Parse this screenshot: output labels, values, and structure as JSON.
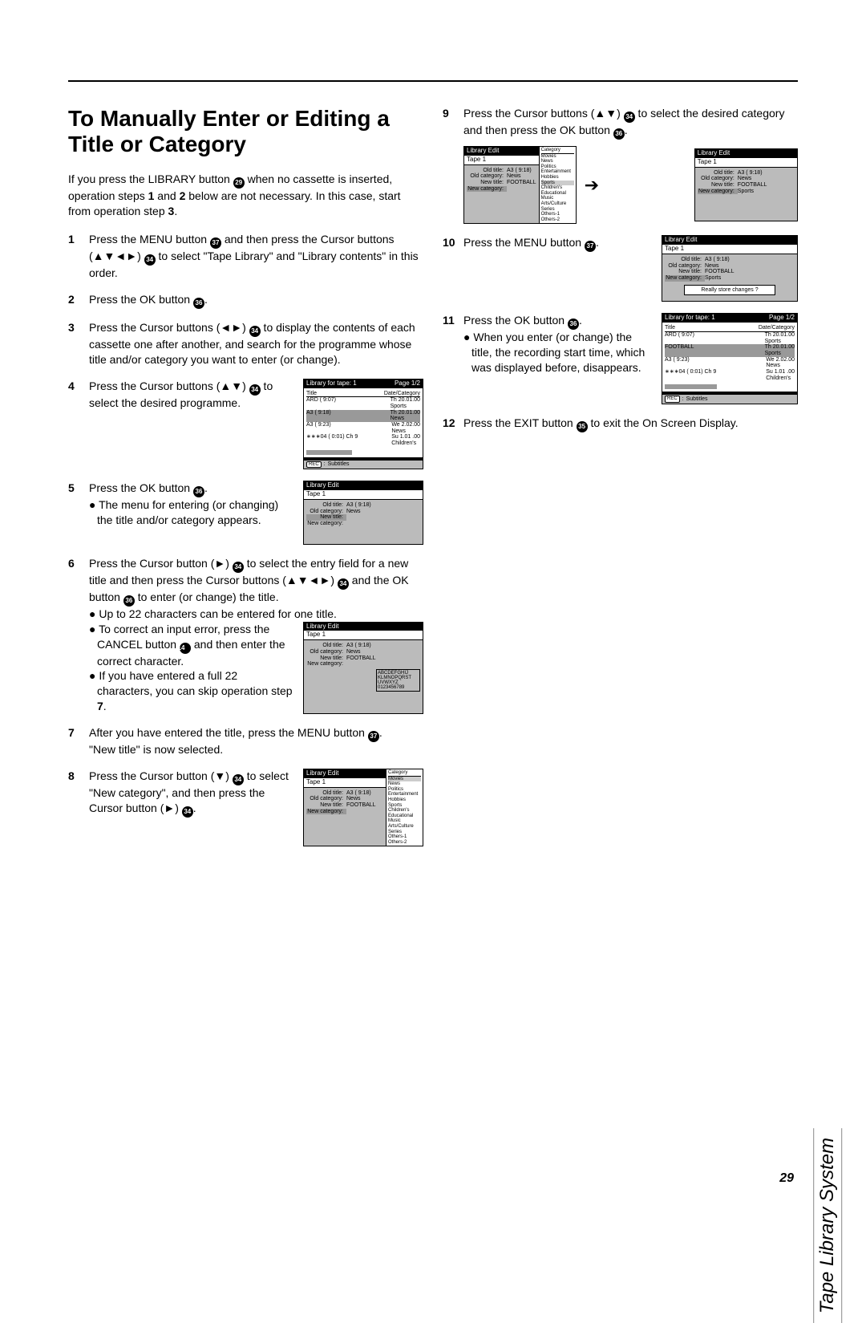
{
  "page_number": "29",
  "side_tab": "Tape Library System",
  "h1": "To Manually Enter or Editing a Title or Category",
  "intro_a": "If you press the LIBRARY button ",
  "intro_b": " when no cassette is inserted, operation steps ",
  "intro_c": " and ",
  "intro_d": " below are not necessary. In this case, start from operation step ",
  "intro_e": ".",
  "bold1": "1",
  "bold2": "2",
  "bold3": "3",
  "step1_a": "Press the MENU button ",
  "step1_b": " and then press the Cursor buttons (▲▼◄►) ",
  "step1_c": " to select \"Tape Library\" and \"Library contents\" in this order.",
  "step2_a": "Press the OK button ",
  "step2_b": ".",
  "step3_a": "Press the Cursor buttons (◄►) ",
  "step3_b": " to display the contents of each cassette one after another, and search for the programme whose title and/or category you want to enter (or change).",
  "step4_a": "Press the Cursor buttons (▲▼) ",
  "step4_b": " to select the desired programme.",
  "step5_a": "Press the OK button ",
  "step5_b": ".",
  "step5_bul": "The menu for entering (or changing) the title and/or category appears.",
  "step6_a": "Press the Cursor button (►) ",
  "step6_b": " to select the entry field for a new title and then press the Cursor buttons (▲▼◄►) ",
  "step6_c": " and the OK button ",
  "step6_d": " to enter (or change) the title.",
  "step6_bul1": "Up to 22 characters can be entered for one title.",
  "step6_bul2a": "To correct an input error, press the CANCEL button ",
  "step6_bul2b": " and then enter the correct character.",
  "step6_bul3": "If you have entered a full 22 characters, you can skip operation step ",
  "step6_bul3b": ".",
  "bold7": "7",
  "step7_a": "After you have entered the title, press the MENU button ",
  "step7_b": ".",
  "step7_c": "\"New title\" is now selected.",
  "step8_a": "Press the Cursor button (▼) ",
  "step8_b": " to select \"New category\", and then press the Cursor button (►) ",
  "step8_c": ".",
  "step9_a": "Press the Cursor buttons (▲▼) ",
  "step9_b": " to select the desired category and then press the OK button ",
  "step9_c": ".",
  "step10_a": "Press the MENU button ",
  "step10_b": ".",
  "step11_a": "Press the OK button ",
  "step11_b": ".",
  "step11_bul": "When you enter (or change) the title, the recording start time, which was displayed before, disappears.",
  "step12_a": "Press the EXIT button ",
  "step12_b": " to exit the On Screen Display.",
  "c29": "29",
  "c37": "37",
  "c34": "34",
  "c36": "36",
  "c14": "14",
  "c35": "35",
  "fig": {
    "library_title": "Library for tape: 1",
    "page": "Page 1/2",
    "col_title": "Title",
    "col_date": "Date/Category",
    "rows": [
      {
        "t": "ARD ( 9:07)",
        "d": "Th    20.01.00",
        "c": "Sports"
      },
      {
        "t": "A3 ( 9:18)",
        "d": "Th    20.01.00",
        "c": "News"
      },
      {
        "t": "A3 ( 9:23)",
        "d": "We    2.02.00",
        "c": "News"
      },
      {
        "t": "∗∗∗04 ( 0:01) Ch 9",
        "d": "Su   1.01 .00",
        "c": "Children's"
      }
    ],
    "subtitles": "Subtitles",
    "rec_chip": "REC",
    "edit_title": "Library Edit",
    "tape": "Tape 1",
    "old_title_k": "Old title:",
    "old_title_v": "A3  (  9:18)",
    "old_cat_k": "Old category:",
    "old_cat_v": "News",
    "new_title_k": "New title:",
    "new_title_v": "FOOTBALL",
    "new_cat_k": "New category:",
    "new_cat_v": "Sports",
    "chars_l1": "ABCDEFGHIJ",
    "chars_l2": "KLMNOPQRST",
    "chars_l3": "UVWXYZ",
    "chars_l4": "0123456789",
    "cat_h": "Category",
    "cats": [
      "Movies",
      "News",
      "Politics",
      "Entertainment",
      "Hobbies",
      "Sports",
      "Children's",
      "Educational",
      "Music",
      "Arts/Culture",
      "Series",
      "Others-1",
      "Others-2"
    ],
    "store": "Really store changes ?",
    "football_row": "FOOTBALL"
  }
}
